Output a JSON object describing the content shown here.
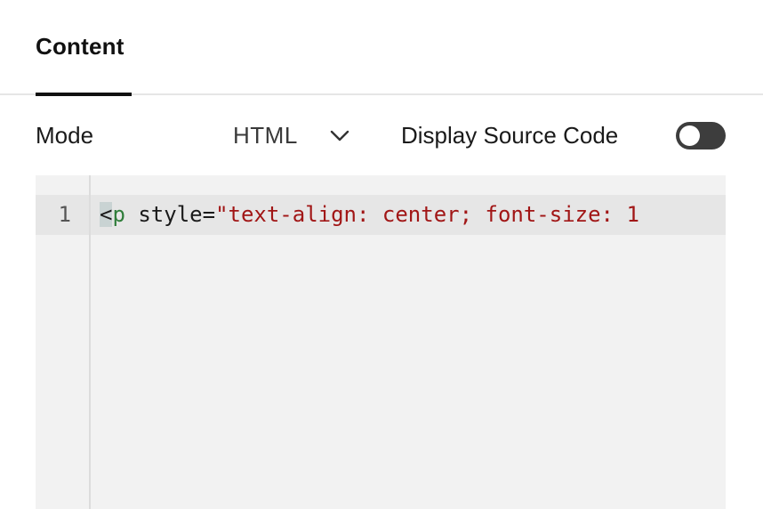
{
  "tabs": [
    {
      "label": "Content",
      "active": true
    }
  ],
  "mode": {
    "label": "Mode",
    "selected": "HTML",
    "dropdown_icon": "chevron-down-icon"
  },
  "source_toggle": {
    "label": "Display Source Code",
    "on": false,
    "track_color": "#3d3d3d"
  },
  "editor": {
    "lines": [
      {
        "number": "1",
        "tokens": {
          "bracket": "<",
          "tag": "p",
          "attr": " style=",
          "string": "\"text-align: center; font-size: 1"
        }
      }
    ],
    "colors": {
      "tag": "#2f7d3a",
      "string": "#a11616",
      "background": "#f2f2f2"
    }
  }
}
